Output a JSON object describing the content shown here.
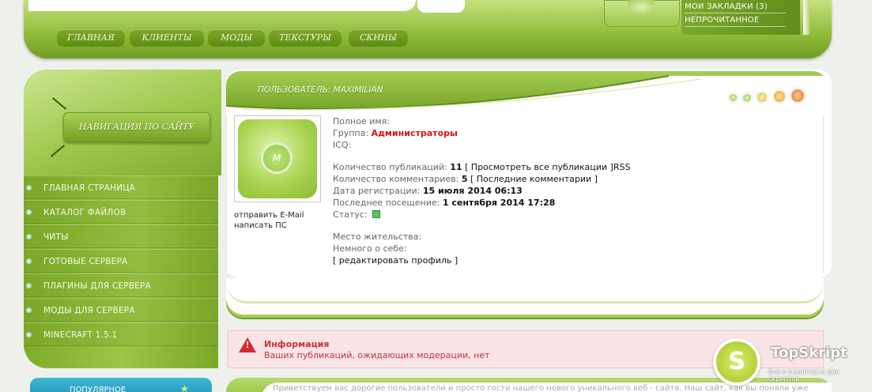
{
  "header": {
    "links": [
      "МОИ ЗАКЛАДКИ (3)",
      "НЕПРОЧИТАННОЕ"
    ],
    "nav": [
      "ГЛАВНАЯ",
      "КЛИЕНТЫ",
      "МОДЫ",
      "ТЕКСТУРЫ",
      "СКИНЫ"
    ]
  },
  "sidebar": {
    "title": "НАВИГАЦИЯ ПО САЙТУ",
    "items": [
      "ГЛАВНАЯ СТРАНИЦА",
      "КАТАЛОГ ФАЙЛОВ",
      "ЧИТЫ",
      "ГОТОВЫЕ СЕРВЕРА",
      "ПЛАГИНЫ ДЛЯ СЕРВЕРА",
      "МОДЫ ДЛЯ СЕРВЕРА",
      "MINECRAFT 1.5.1"
    ],
    "popular": "ПОПУЛЯРНОЕ"
  },
  "profile": {
    "title": "ПОЛЬЗОВАТЕЛЬ: MAXIMILIAN",
    "links": [
      "отправить E-Mail",
      "написать ПС"
    ],
    "fullname_label": "Полное имя:",
    "group_label": "Группа:",
    "group_value": "Администраторы",
    "icq_label": "ICQ:",
    "pubs_label": "Количество публикаций:",
    "pubs_value": "11",
    "pubs_link": "[ Просмотреть все публикации ]",
    "pubs_rss": "RSS",
    "comments_label": "Количество комментариев:",
    "comments_value": "5",
    "comments_link": "[ Последние комментарии ]",
    "reg_label": "Дата регистрации:",
    "reg_value": "15 июля 2014 06:13",
    "last_label": "Последнее посещение:",
    "last_value": "1 сентября 2014 17:28",
    "status_label": "Статус:",
    "residence_label": "Место жительства:",
    "about_label": "Немного о себе:",
    "edit_link": "[ редактировать профиль ]"
  },
  "alert": {
    "title": "Информация",
    "text": "Ваших публикаций, ожидающих модерации, нет"
  },
  "lower": {
    "text": "Приветствуем вас дорогие пользователи и просто гости нашего нового уникального веб - сайта. Наш сайт, как вы поняли уже по"
  },
  "watermark": {
    "letter": "S",
    "brand": "TopSkript",
    "tagline": "Все о скриптах и для скриптов..."
  },
  "colors": {
    "accent_green": "#8dbb3a",
    "group_red": "#d41313",
    "alert_red": "#c7323b",
    "status_online": "#58c45d"
  }
}
